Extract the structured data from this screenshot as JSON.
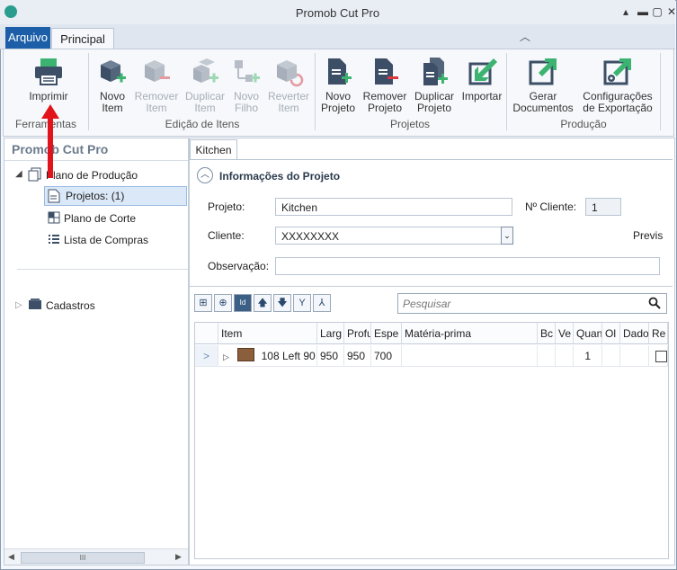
{
  "window": {
    "title": "Promob Cut Pro"
  },
  "tabs": {
    "arquivo": "Arquivo",
    "principal": "Principal"
  },
  "ribbon": {
    "groups": {
      "ferramentas": "Ferramentas",
      "edicao": "Edição de Itens",
      "projetos": "Projetos",
      "producao": "Produção"
    },
    "buttons": {
      "imprimir": "Imprimir",
      "novo_item": [
        "Novo",
        "Item"
      ],
      "remover_item": [
        "Remover",
        "Item"
      ],
      "duplicar_item": [
        "Duplicar",
        "Item"
      ],
      "novo_filho": [
        "Novo",
        "Filho"
      ],
      "reverter_item": [
        "Reverter",
        "Item"
      ],
      "novo_projeto": [
        "Novo",
        "Projeto"
      ],
      "remover_projeto": [
        "Remover",
        "Projeto"
      ],
      "duplicar_projeto": [
        "Duplicar",
        "Projeto"
      ],
      "importar": "Importar",
      "gerar_documentos": [
        "Gerar",
        "Documentos"
      ],
      "config_export": [
        "Configurações",
        "de Exportação"
      ]
    }
  },
  "left_panel": {
    "title": "Promob Cut Pro",
    "tree": {
      "plano_producao": "Plano de Produção",
      "projetos": "Projetos: (1)",
      "plano_corte": "Plano de Corte",
      "lista_compras": "Lista de Compras",
      "cadastros": "Cadastros"
    },
    "scroll_thumb": "III"
  },
  "right_panel": {
    "doc_tab": "Kitchen",
    "section_title": "Informações do Projeto",
    "labels": {
      "projeto": "Projeto:",
      "cliente": "Cliente:",
      "observacao": "Observação:",
      "n_cliente": "Nº Cliente:",
      "previs": "Previs"
    },
    "values": {
      "projeto": "Kitchen",
      "cliente": "XXXXXXXX",
      "n_cliente": "1",
      "observacao": ""
    },
    "search_placeholder": "Pesquisar",
    "grid": {
      "columns": [
        "Item",
        "Larg",
        "Profu",
        "Espe",
        "Matéria-prima",
        "Bc",
        "Ve",
        "Quan",
        "Ol",
        "Dado",
        "Re"
      ],
      "rows": [
        {
          "item": "108 Left 90",
          "larg": "950",
          "prof": "950",
          "esp": "700",
          "materia": "",
          "quant": "1"
        }
      ]
    }
  },
  "colors": {
    "accent": "#1c5fa8",
    "red_annotation": "#e0141a",
    "icon_dark": "#3c4f66",
    "icon_green": "#3cb371"
  }
}
